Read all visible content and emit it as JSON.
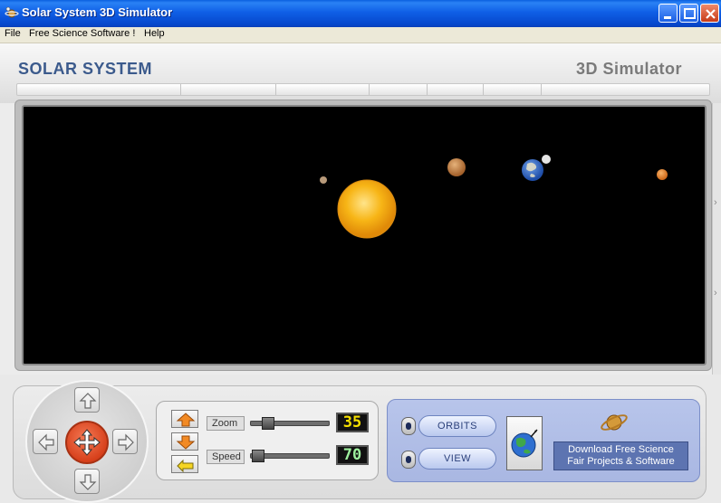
{
  "window": {
    "title": "Solar System 3D Simulator",
    "icons": {
      "app": "satellite-icon",
      "minimize": "minimize-icon",
      "maximize": "maximize-icon",
      "close": "close-icon"
    }
  },
  "menu": {
    "items": [
      "File",
      "Free Science Software !",
      "Help"
    ]
  },
  "header": {
    "brand_left": "SOLAR SYSTEM",
    "brand_right": "3D Simulator"
  },
  "viewport": {
    "background": "#000000",
    "bodies": [
      "sun",
      "mercury",
      "mars",
      "earth",
      "moon",
      "venus"
    ]
  },
  "navigation": {
    "up_icon": "arrow-up-icon",
    "down_icon": "arrow-down-icon",
    "left_icon": "arrow-left-icon",
    "right_icon": "arrow-right-icon",
    "center_icon": "move-icon",
    "center_color": "#e0522c"
  },
  "controls": {
    "zoom": {
      "label": "Zoom",
      "value": "35"
    },
    "speed": {
      "label": "Speed",
      "value": "70"
    },
    "buttons": {
      "up": "orange-up-arrow-icon",
      "down": "orange-down-arrow-icon",
      "back": "yellow-return-arrow-icon"
    }
  },
  "view_panel": {
    "orbits_label": "ORBITS",
    "view_label": "VIEW",
    "globe_icon": "globe-icon",
    "saturn_icon": "saturn-icon",
    "promo_line1": "Download Free Science",
    "promo_line2": "Fair Projects & Software"
  }
}
